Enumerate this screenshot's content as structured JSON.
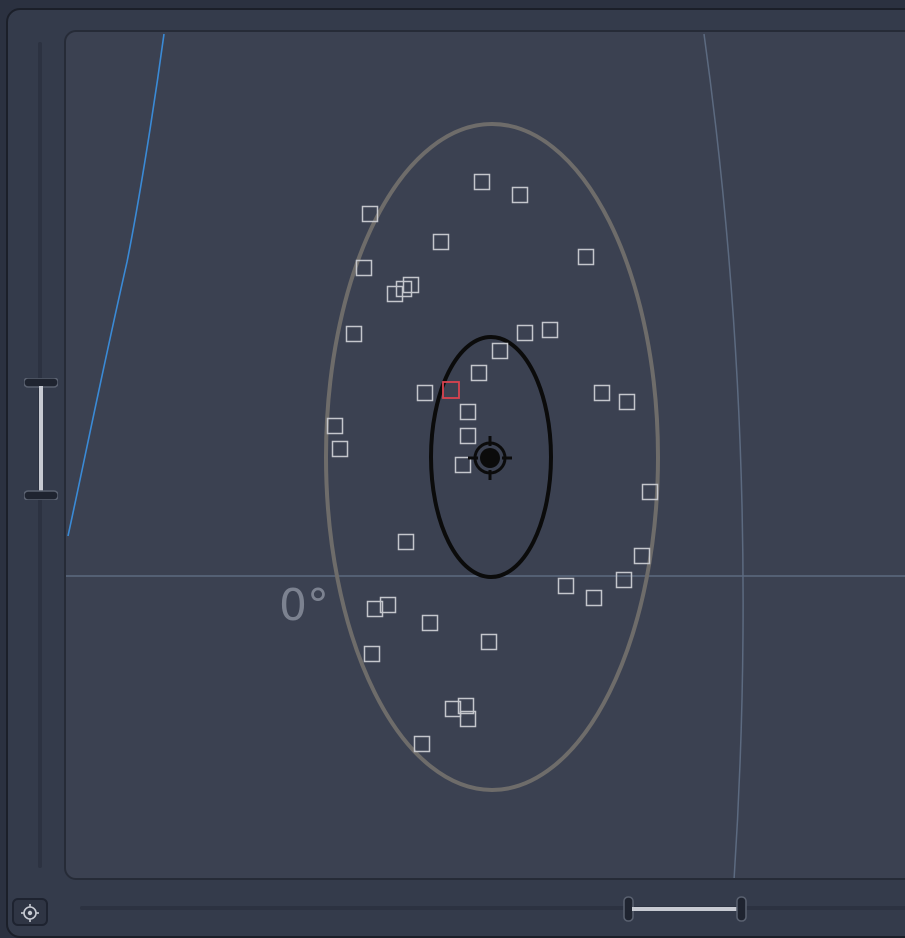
{
  "view": {
    "angle_label": "0°",
    "colors": {
      "outer_ellipse": "#6e6c6a",
      "inner_ellipse": "#0b0b0b",
      "marker": "#c4c6cc",
      "highlight_marker": "#d9434f",
      "blue_curve": "#3a8ad6",
      "grid_line": "#5c6a80",
      "center_target": "#0b0b0b"
    }
  },
  "icons": {
    "locate": "locate-icon",
    "center": "crosshair-icon"
  }
}
